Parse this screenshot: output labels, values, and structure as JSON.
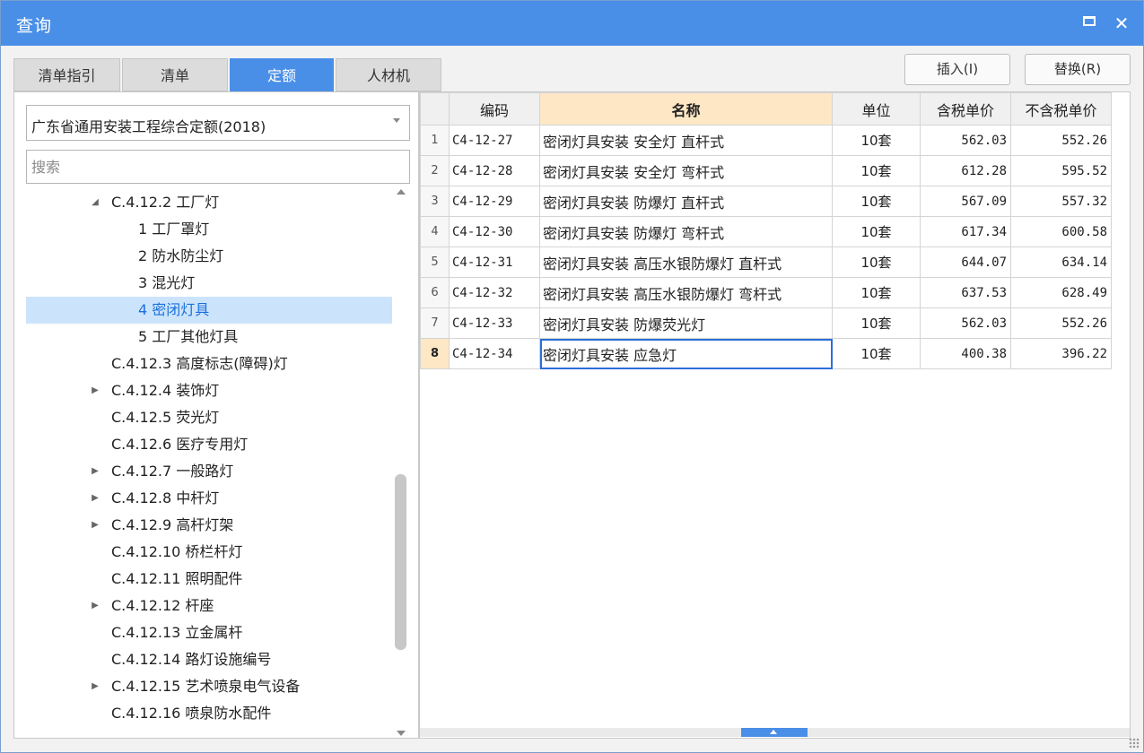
{
  "window": {
    "title": "查询"
  },
  "tabs": [
    {
      "label": "清单指引",
      "active": false
    },
    {
      "label": "清单",
      "active": false
    },
    {
      "label": "定额",
      "active": true
    },
    {
      "label": "人材机",
      "active": false
    }
  ],
  "toolbar": {
    "insert_label": "插入(I)",
    "replace_label": "替换(R)"
  },
  "library_select": {
    "value": "广东省通用安装工程综合定额(2018)"
  },
  "search": {
    "placeholder": "搜索"
  },
  "tree": [
    {
      "label": "C.4.12.2 工厂灯",
      "level": 1,
      "toggle": "expanded",
      "selected": false
    },
    {
      "label": "1 工厂罩灯",
      "level": 2,
      "toggle": "none",
      "selected": false
    },
    {
      "label": "2 防水防尘灯",
      "level": 2,
      "toggle": "none",
      "selected": false
    },
    {
      "label": "3 混光灯",
      "level": 2,
      "toggle": "none",
      "selected": false
    },
    {
      "label": "4 密闭灯具",
      "level": 2,
      "toggle": "none",
      "selected": true
    },
    {
      "label": "5 工厂其他灯具",
      "level": 2,
      "toggle": "none",
      "selected": false
    },
    {
      "label": "C.4.12.3 高度标志(障碍)灯",
      "level": 1,
      "toggle": "none",
      "selected": false
    },
    {
      "label": "C.4.12.4 装饰灯",
      "level": 1,
      "toggle": "collapsed",
      "selected": false
    },
    {
      "label": "C.4.12.5 荧光灯",
      "level": 1,
      "toggle": "none",
      "selected": false
    },
    {
      "label": "C.4.12.6 医疗专用灯",
      "level": 1,
      "toggle": "none",
      "selected": false
    },
    {
      "label": "C.4.12.7 一般路灯",
      "level": 1,
      "toggle": "collapsed",
      "selected": false
    },
    {
      "label": "C.4.12.8 中杆灯",
      "level": 1,
      "toggle": "collapsed",
      "selected": false
    },
    {
      "label": "C.4.12.9 高杆灯架",
      "level": 1,
      "toggle": "collapsed",
      "selected": false
    },
    {
      "label": "C.4.12.10 桥栏杆灯",
      "level": 1,
      "toggle": "none",
      "selected": false
    },
    {
      "label": "C.4.12.11 照明配件",
      "level": 1,
      "toggle": "none",
      "selected": false
    },
    {
      "label": "C.4.12.12 杆座",
      "level": 1,
      "toggle": "collapsed",
      "selected": false
    },
    {
      "label": "C.4.12.13 立金属杆",
      "level": 1,
      "toggle": "none",
      "selected": false
    },
    {
      "label": "C.4.12.14 路灯设施编号",
      "level": 1,
      "toggle": "none",
      "selected": false
    },
    {
      "label": "C.4.12.15 艺术喷泉电气设备",
      "level": 1,
      "toggle": "collapsed",
      "selected": false
    },
    {
      "label": "C.4.12.16 喷泉防水配件",
      "level": 1,
      "toggle": "none",
      "selected": false
    }
  ],
  "grid": {
    "headers": [
      "",
      "编码",
      "名称",
      "单位",
      "含税单价",
      "不含税单价"
    ],
    "rows": [
      {
        "index": "1",
        "code": "C4-12-27",
        "name": "密闭灯具安装 安全灯 直杆式",
        "unit": "10套",
        "price_tax": "562.03",
        "price_notax": "552.26"
      },
      {
        "index": "2",
        "code": "C4-12-28",
        "name": "密闭灯具安装 安全灯 弯杆式",
        "unit": "10套",
        "price_tax": "612.28",
        "price_notax": "595.52"
      },
      {
        "index": "3",
        "code": "C4-12-29",
        "name": "密闭灯具安装 防爆灯 直杆式",
        "unit": "10套",
        "price_tax": "567.09",
        "price_notax": "557.32"
      },
      {
        "index": "4",
        "code": "C4-12-30",
        "name": "密闭灯具安装 防爆灯 弯杆式",
        "unit": "10套",
        "price_tax": "617.34",
        "price_notax": "600.58"
      },
      {
        "index": "5",
        "code": "C4-12-31",
        "name": "密闭灯具安装 高压水银防爆灯 直杆式",
        "unit": "10套",
        "price_tax": "644.07",
        "price_notax": "634.14"
      },
      {
        "index": "6",
        "code": "C4-12-32",
        "name": "密闭灯具安装 高压水银防爆灯 弯杆式",
        "unit": "10套",
        "price_tax": "637.53",
        "price_notax": "628.49"
      },
      {
        "index": "7",
        "code": "C4-12-33",
        "name": "密闭灯具安装 防爆荧光灯",
        "unit": "10套",
        "price_tax": "562.03",
        "price_notax": "552.26"
      },
      {
        "index": "8",
        "code": "C4-12-34",
        "name": "密闭灯具安装 应急灯",
        "unit": "10套",
        "price_tax": "400.38",
        "price_notax": "396.22"
      }
    ],
    "current_row": 8
  },
  "colors": {
    "accent": "#4a8fe7",
    "selection_bg": "#cce4fb",
    "header_highlight": "#fde7c5"
  }
}
